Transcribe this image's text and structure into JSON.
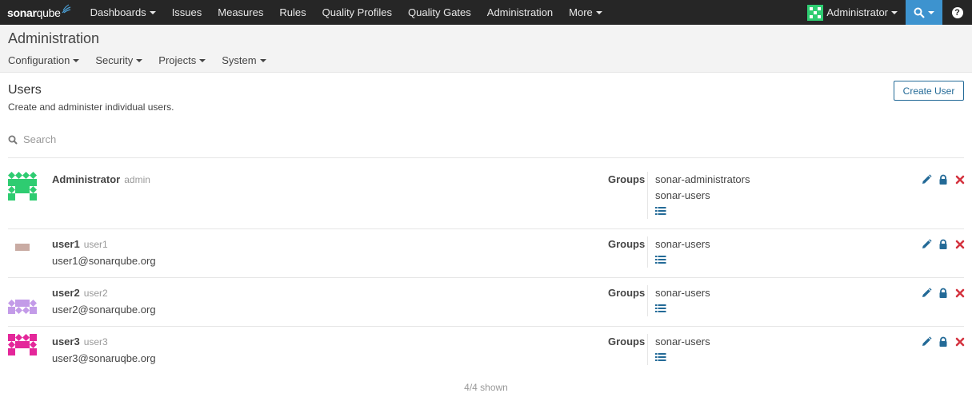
{
  "navbar": {
    "logo": {
      "sonar": "sonar",
      "qube": "qube"
    },
    "items": [
      {
        "label": "Dashboards",
        "dropdown": true
      },
      {
        "label": "Issues",
        "dropdown": false
      },
      {
        "label": "Measures",
        "dropdown": false
      },
      {
        "label": "Rules",
        "dropdown": false
      },
      {
        "label": "Quality Profiles",
        "dropdown": false
      },
      {
        "label": "Quality Gates",
        "dropdown": false
      },
      {
        "label": "Administration",
        "dropdown": false
      },
      {
        "label": "More",
        "dropdown": true
      }
    ],
    "user_label": "Administrator",
    "accent_color": "#3d93cf"
  },
  "page": {
    "title": "Administration",
    "subnav": [
      "Configuration",
      "Security",
      "Projects",
      "System"
    ]
  },
  "users_section": {
    "title": "Users",
    "description": "Create and administer individual users.",
    "create_button": "Create User",
    "search_placeholder": "Search",
    "groups_label": "Groups",
    "count_text": "4/4 shown"
  },
  "users": [
    {
      "name": "Administrator",
      "login": "admin",
      "email": "",
      "groups": [
        "sonar-administrators",
        "sonar-users"
      ],
      "avatar_color": "#2ecc71"
    },
    {
      "name": "user1",
      "login": "user1",
      "email": "user1@sonarqube.org",
      "groups": [
        "sonar-users"
      ],
      "avatar_color": "#c9aba3"
    },
    {
      "name": "user2",
      "login": "user2",
      "email": "user2@sonarqube.org",
      "groups": [
        "sonar-users"
      ],
      "avatar_color": "#c39be8"
    },
    {
      "name": "user3",
      "login": "user3",
      "email": "user3@sonaruqbe.org",
      "groups": [
        "sonar-users"
      ],
      "avatar_color": "#e4279a"
    }
  ],
  "icons": {
    "edit": "pencil-icon",
    "password": "lock-icon",
    "deactivate": "close-icon",
    "groups_list": "list-icon",
    "search": "search-icon",
    "help": "help-icon"
  },
  "colors": {
    "edit": "#236a97",
    "lock": "#236a97",
    "delete": "#d4333f"
  }
}
